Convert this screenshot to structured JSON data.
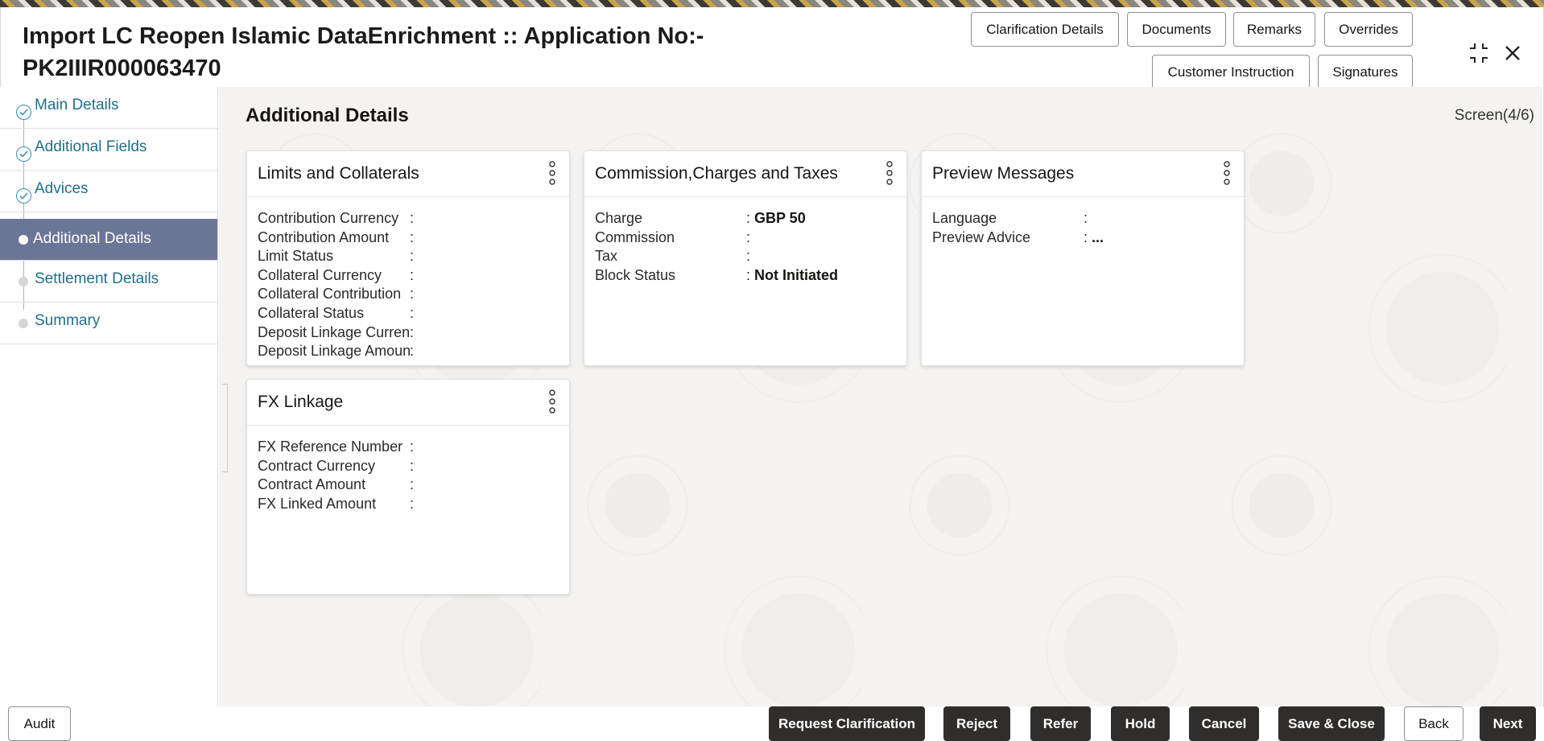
{
  "header": {
    "title": "Import LC Reopen Islamic DataEnrichment :: Application No:- PK2IIIR000063470",
    "buttons": {
      "clarification_details": "Clarification Details",
      "documents": "Documents",
      "remarks": "Remarks",
      "overrides": "Overrides",
      "customer_instruction": "Customer Instruction",
      "signatures": "Signatures"
    },
    "icons": [
      "collapse-icon",
      "close-icon"
    ]
  },
  "sidebar": {
    "items": [
      {
        "label": "Main Details",
        "state": "completed"
      },
      {
        "label": "Additional Fields",
        "state": "completed"
      },
      {
        "label": "Advices",
        "state": "completed"
      },
      {
        "label": "Additional Details",
        "state": "active"
      },
      {
        "label": "Settlement Details",
        "state": "pending"
      },
      {
        "label": "Summary",
        "state": "pending"
      }
    ]
  },
  "main": {
    "section_title": "Additional Details",
    "screen_indicator": "Screen(4/6)",
    "cards": {
      "limits": {
        "title": "Limits and Collaterals",
        "rows": [
          {
            "key": "Contribution Currency",
            "value": ""
          },
          {
            "key": "Contribution Amount",
            "value": ""
          },
          {
            "key": "Limit Status",
            "value": ""
          },
          {
            "key": "Collateral Currency",
            "value": ""
          },
          {
            "key": "Collateral Contribution",
            "value": ""
          },
          {
            "key": "Collateral Status",
            "value": ""
          },
          {
            "key": "Deposit Linkage Currency",
            "value": ""
          },
          {
            "key": "Deposit Linkage Amount",
            "value": ""
          }
        ]
      },
      "commission": {
        "title": "Commission,Charges and Taxes",
        "rows": [
          {
            "key": "Charge",
            "value": "GBP 50"
          },
          {
            "key": "Commission",
            "value": ""
          },
          {
            "key": "Tax",
            "value": ""
          },
          {
            "key": "Block Status",
            "value": "Not Initiated"
          }
        ]
      },
      "preview": {
        "title": "Preview Messages",
        "rows": [
          {
            "key": "Language",
            "value": ""
          },
          {
            "key": "Preview Advice",
            "value": "..."
          }
        ]
      },
      "fx": {
        "title": "FX Linkage",
        "rows": [
          {
            "key": "FX Reference Number",
            "value": ""
          },
          {
            "key": "Contract Currency",
            "value": ""
          },
          {
            "key": "Contract Amount",
            "value": ""
          },
          {
            "key": "FX Linked Amount",
            "value": ""
          }
        ]
      }
    }
  },
  "footer": {
    "audit": "Audit",
    "request_clarification": "Request Clarification",
    "reject": "Reject",
    "refer": "Refer",
    "hold": "Hold",
    "cancel": "Cancel",
    "save_close": "Save & Close",
    "back": "Back",
    "next": "Next"
  },
  "colors": {
    "active_step": "#6b7596",
    "link": "#1d6f8e",
    "dark_button": "#302e2c"
  }
}
